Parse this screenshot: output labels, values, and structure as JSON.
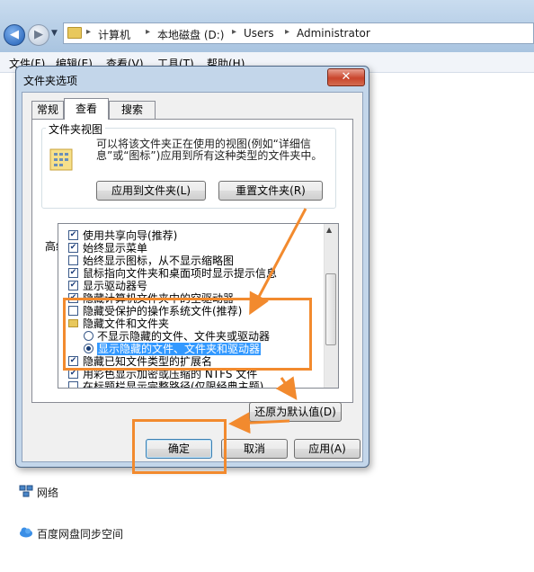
{
  "explorer": {
    "breadcrumbs": [
      "计算机",
      "本地磁盘 (D:)",
      "Users",
      "Administrator"
    ],
    "menu": [
      "文件(F)",
      "编辑(E)",
      "查看(V)",
      "工具(T)",
      "帮助(H)"
    ],
    "sidebar": [
      {
        "label": "网络",
        "icon": "network-icon"
      },
      {
        "label": "百度网盘同步空间",
        "icon": "cloud-sync-icon"
      }
    ]
  },
  "dialog": {
    "title": "文件夹选项",
    "close_glyph": "✕",
    "tabs": [
      "常规",
      "查看",
      "搜索"
    ],
    "active_tab": "查看",
    "folder_view": {
      "title": "文件夹视图",
      "description": "可以将该文件夹正在使用的视图(例如“详细信息”或“图标”)应用到所有这种类型的文件夹中。",
      "apply_button": "应用到文件夹(L)",
      "reset_button": "重置文件夹(R)"
    },
    "advanced_label": "高级设置:",
    "settings": [
      {
        "type": "checkbox",
        "checked": true,
        "label": "使用共享向导(推荐)"
      },
      {
        "type": "checkbox",
        "checked": true,
        "label": "始终显示菜单"
      },
      {
        "type": "checkbox",
        "checked": false,
        "label": "始终显示图标，从不显示缩略图"
      },
      {
        "type": "checkbox",
        "checked": true,
        "label": "鼠标指向文件夹和桌面项时显示提示信息"
      },
      {
        "type": "checkbox",
        "checked": true,
        "label": "显示驱动器号"
      },
      {
        "type": "checkbox",
        "checked": true,
        "label": "隐藏计算机文件夹中的空驱动器"
      },
      {
        "type": "checkbox",
        "checked": false,
        "label": "隐藏受保护的操作系统文件(推荐)"
      },
      {
        "type": "folder",
        "label": "隐藏文件和文件夹"
      },
      {
        "type": "radio",
        "checked": false,
        "label": "不显示隐藏的文件、文件夹或驱动器"
      },
      {
        "type": "radio",
        "checked": true,
        "label": "显示隐藏的文件、文件夹和驱动器"
      },
      {
        "type": "checkbox",
        "checked": true,
        "label": "隐藏已知文件类型的扩展名"
      },
      {
        "type": "checkbox",
        "checked": true,
        "label": "用彩色显示加密或压缩的 NTFS 文件"
      },
      {
        "type": "checkbox",
        "checked": false,
        "label": "在标题栏显示完整路径(仅限经典主题)"
      }
    ],
    "restore_button": "还原为默认值(D)",
    "ok_button": "确定",
    "cancel_button": "取消",
    "apply_button": "应用(A)"
  },
  "colors": {
    "annotation": "#f28a2e",
    "selection": "#3399ff"
  }
}
